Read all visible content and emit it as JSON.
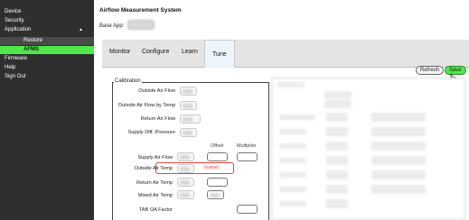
{
  "sidebar": {
    "items": [
      {
        "label": "Device"
      },
      {
        "label": "Security"
      },
      {
        "label": "Application",
        "caret": "▲"
      },
      {
        "label": "Restore"
      },
      {
        "label": "AFMS"
      },
      {
        "label": "Firmware"
      },
      {
        "label": "Help"
      },
      {
        "label": "Sign Out"
      }
    ]
  },
  "header": {
    "title": "Airflow Measurement System",
    "base_app_label": "Base App:"
  },
  "tabs": [
    {
      "label": "Monitor"
    },
    {
      "label": "Configure"
    },
    {
      "label": "Learn"
    },
    {
      "label": "Tune",
      "active": true
    }
  ],
  "toolbar": {
    "refresh_label": "Refresh",
    "save_label": "Save"
  },
  "calibration": {
    "legend": "Calibration",
    "col_offset": "Offset",
    "col_multiplier": "Multiplier",
    "rows": [
      {
        "label": "Outside Air Flow"
      },
      {
        "label": "Outside Air Flow by Temp"
      },
      {
        "label": "Return Air Flow"
      },
      {
        "label": "Supply Diff. Pressure"
      },
      {
        "label": "Supply Air Flow"
      },
      {
        "label": "Outside Air Temp",
        "offset_placeholder": "(value)"
      },
      {
        "label": "Return Air Temp"
      },
      {
        "label": "Mixed Air Temp"
      },
      {
        "label": "TAB OA Factor"
      }
    ]
  },
  "colors": {
    "sidebar_bg": "#2f2f2f",
    "accent_green": "#4fe84b",
    "highlight_red": "#e0453d"
  }
}
